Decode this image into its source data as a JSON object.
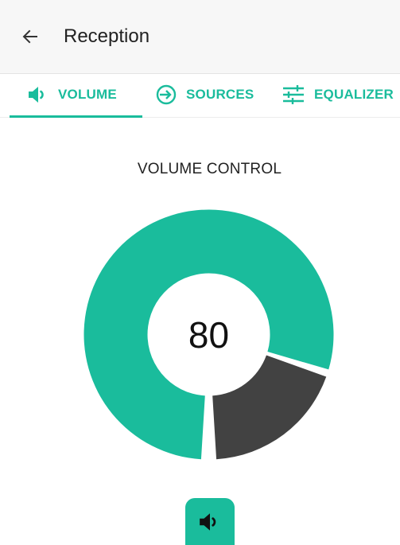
{
  "header": {
    "title": "Reception",
    "back_icon": "arrow-left-icon"
  },
  "tabs": [
    {
      "label": "VOLUME",
      "icon": "speaker-icon",
      "active": true
    },
    {
      "label": "SOURCES",
      "icon": "input-arrow-icon",
      "active": false
    },
    {
      "label": "EQUALIZER",
      "icon": "equalizer-sliders-icon",
      "active": false
    }
  ],
  "volume": {
    "heading": "VOLUME CONTROL",
    "value": "80",
    "level": 80,
    "max": 100
  },
  "mute_button": {
    "icon": "speaker-icon"
  },
  "colors": {
    "accent": "#1abc9c",
    "remaining": "#424242",
    "appbar_bg": "#f7f7f7"
  }
}
